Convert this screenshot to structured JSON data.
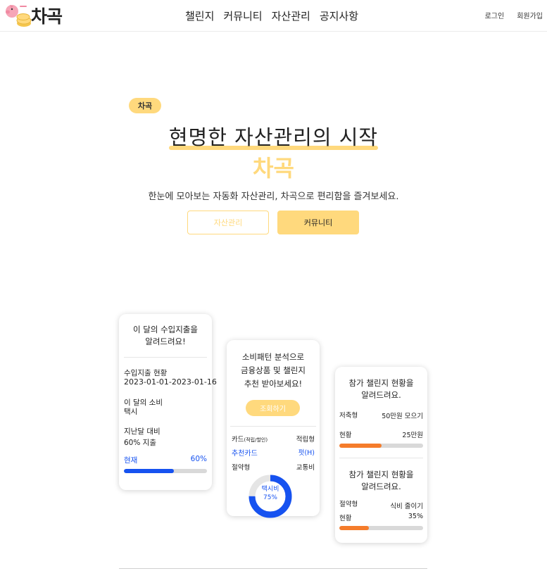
{
  "header": {
    "logo_text": "차곡",
    "nav": [
      "챌린지",
      "커뮤니티",
      "자산관리",
      "공지사항"
    ],
    "login": "로그인",
    "signup": "회원가입"
  },
  "hero": {
    "badge": "차곡",
    "title": "현명한 자산관리의 시작",
    "brand": "차곡",
    "subtitle": "한눈에 모아보는 자동화 자산관리, 차곡으로 편리함을 즐겨보세요.",
    "btn_asset": "자산관리",
    "btn_community": "커뮤니티"
  },
  "card1": {
    "title_l1": "이 달의 수입지출을",
    "title_l2": "알려드려요!",
    "status_label": "수입지출 현황",
    "status_value": "2023-01-01-2023-01-16",
    "spend_label": "이 달의 소비",
    "spend_value": "택시",
    "compare_label": "지난달 대비",
    "compare_value": "60% 지출",
    "bar_label": "현재",
    "bar_value": "60%",
    "progress": 0.6
  },
  "card2": {
    "title_l1": "소비패턴 분석으로",
    "title_l2": "금융상품 및 챌린지",
    "title_l3": "추천 받아보세요!",
    "button": "조회하기",
    "row1_left": "카드",
    "row1_left_small": "(적립/할인)",
    "row1_right": "적립형",
    "row2_left": "추천카드",
    "row2_right": "펏(H)",
    "row3_left": "절약형",
    "row3_right": "교통비",
    "donut_label": "택시비",
    "donut_value": "75%",
    "donut_fraction": 0.75
  },
  "card3": {
    "a_title_l1": "참가 챌린지 현황을",
    "a_title_l2": "알려드려요.",
    "a_row_label": "저축형",
    "a_row_value": "50만원 모으기",
    "a_bar_label": "현황",
    "a_bar_value": "25만원",
    "a_progress": 0.5,
    "b_title_l1": "참가 챌린지 현황을",
    "b_title_l2": "알려드려요.",
    "b_row_label": "절약형",
    "b_row_value": "식비 줄이기",
    "b_bar_label": "현황",
    "b_bar_value": "35%",
    "b_progress": 0.35
  },
  "colors": {
    "accent": "#ffd97d",
    "blue": "#1652f0",
    "orange": "#f57c2b"
  }
}
